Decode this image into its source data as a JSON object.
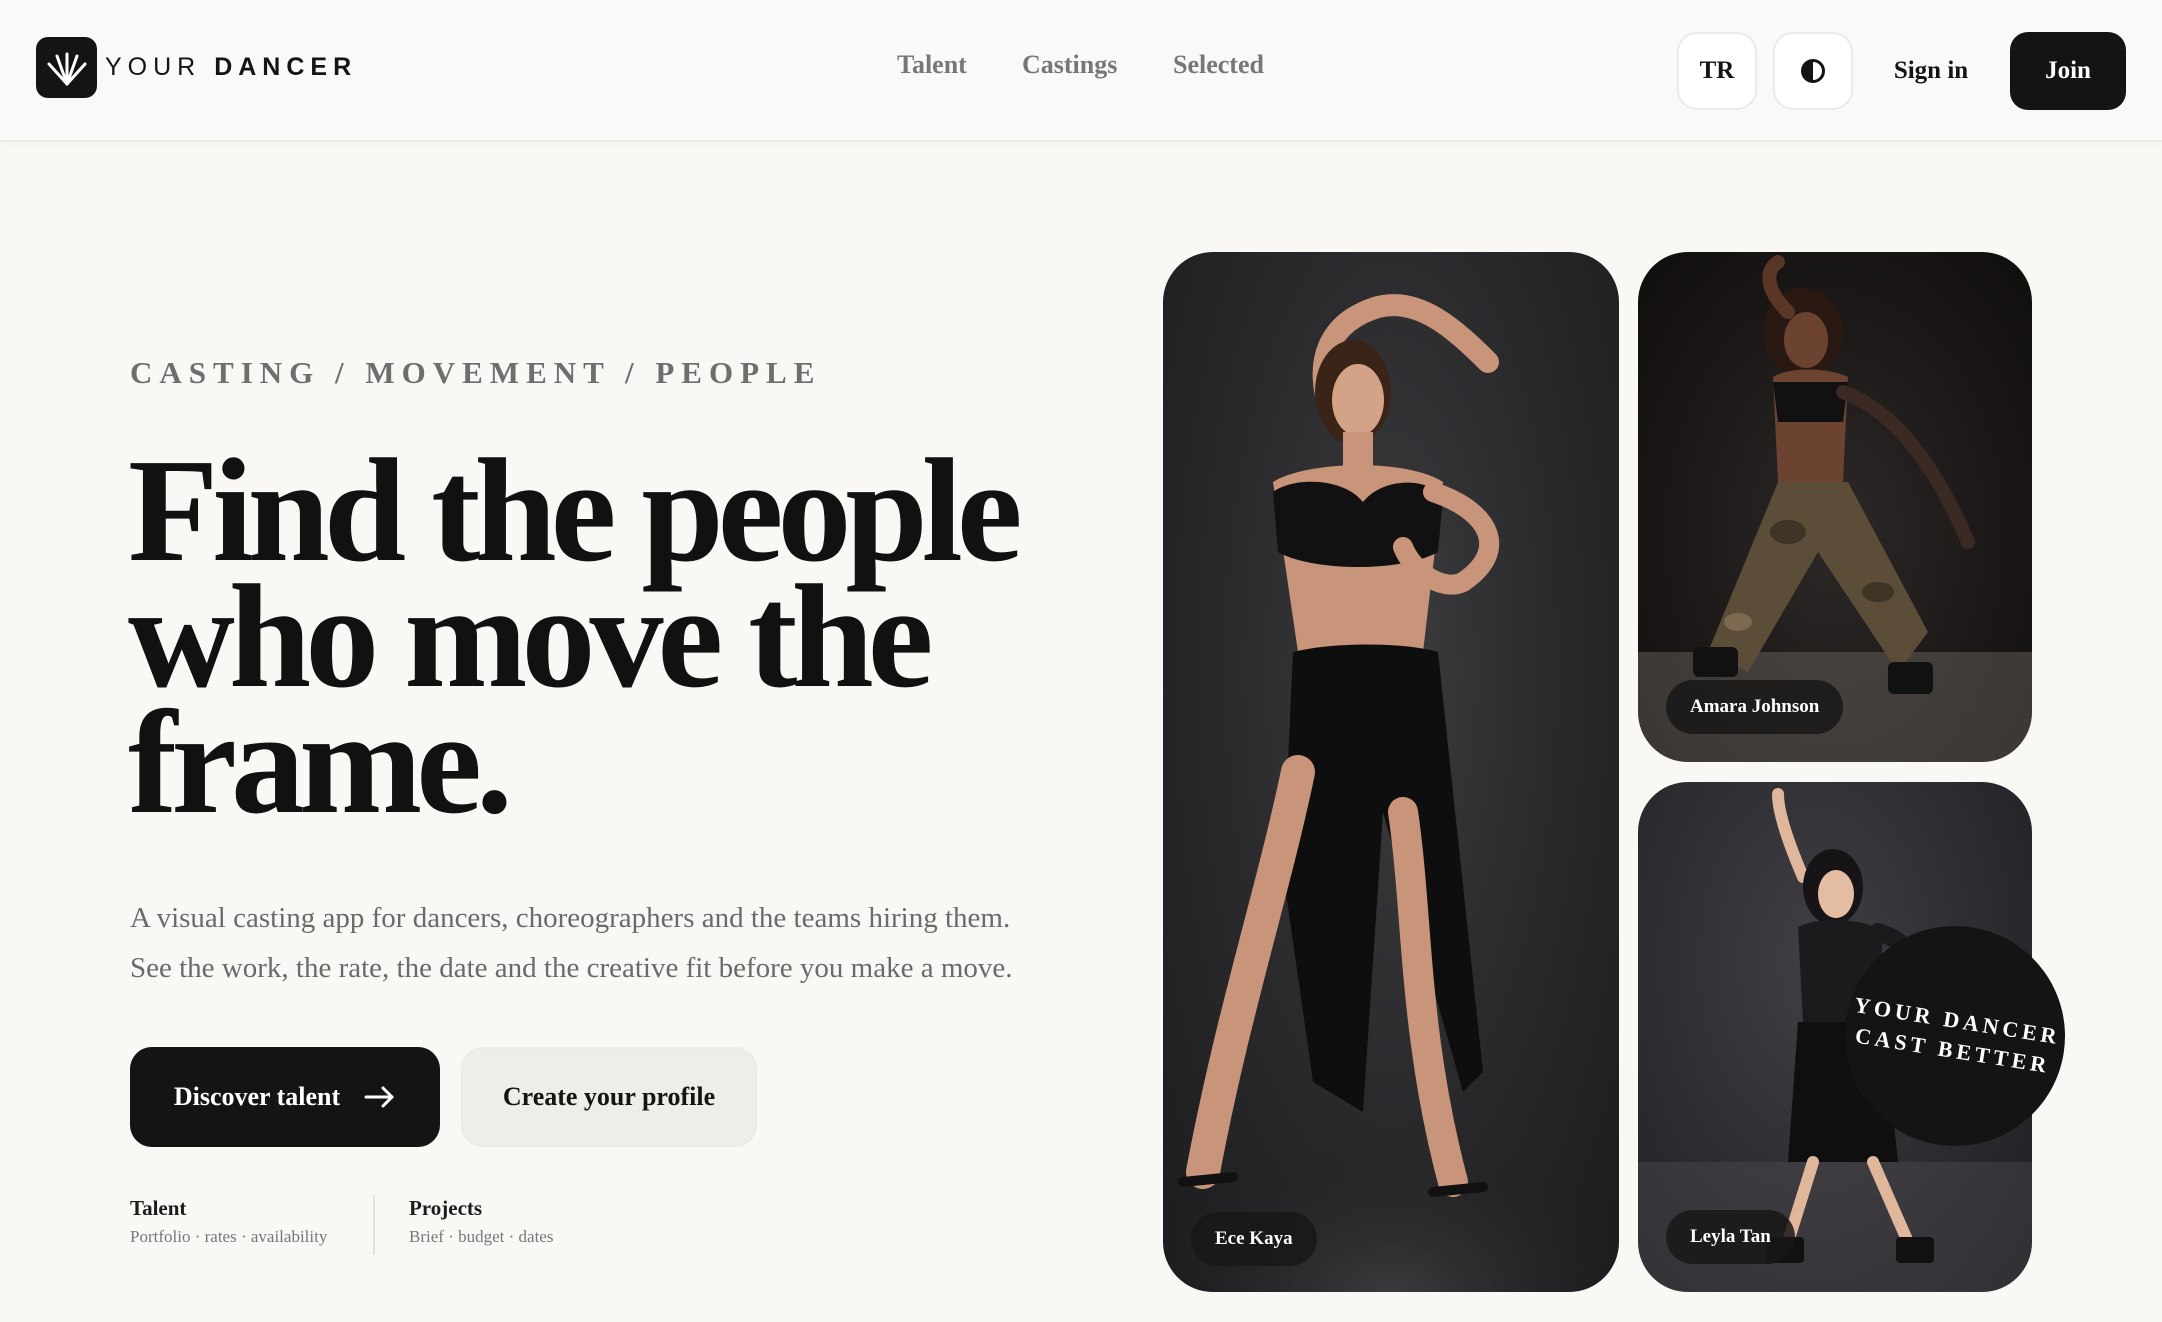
{
  "brand": {
    "logo_word1": "YOUR",
    "logo_word2": "DANCER"
  },
  "nav": {
    "items": [
      "Talent",
      "Castings",
      "Selected"
    ]
  },
  "header_actions": {
    "language": "TR",
    "theme_icon": "half-circle-contrast-icon",
    "sign_in": "Sign in",
    "join": "Join"
  },
  "hero": {
    "eyebrow": "CASTING / MOVEMENT / PEOPLE",
    "headline_lines": [
      "Find the people",
      "who move the",
      "frame."
    ],
    "subcopy_lines": [
      "A visual casting app for dancers, choreographers and the teams hiring them.",
      "See the work, the rate, the date and the creative fit before you make a move."
    ],
    "primary_cta": "Discover talent",
    "primary_cta_icon": "arrow-right-icon",
    "secondary_cta": "Create your profile"
  },
  "meta": [
    {
      "title": "Talent",
      "subtitle": "Portfolio · rates · availability"
    },
    {
      "title": "Projects",
      "subtitle": "Brief · budget · dates"
    }
  ],
  "cards": [
    {
      "name": "Ece Kaya"
    },
    {
      "name": "Amara Johnson"
    },
    {
      "name": "Leyla Tan"
    }
  ],
  "badge": {
    "line1": "YOUR DANCER",
    "line2": "CAST BETTER"
  },
  "colors": {
    "background": "#f9f8f5",
    "ink": "#141414",
    "muted": "#777777",
    "secondary_button": "#efede7"
  }
}
